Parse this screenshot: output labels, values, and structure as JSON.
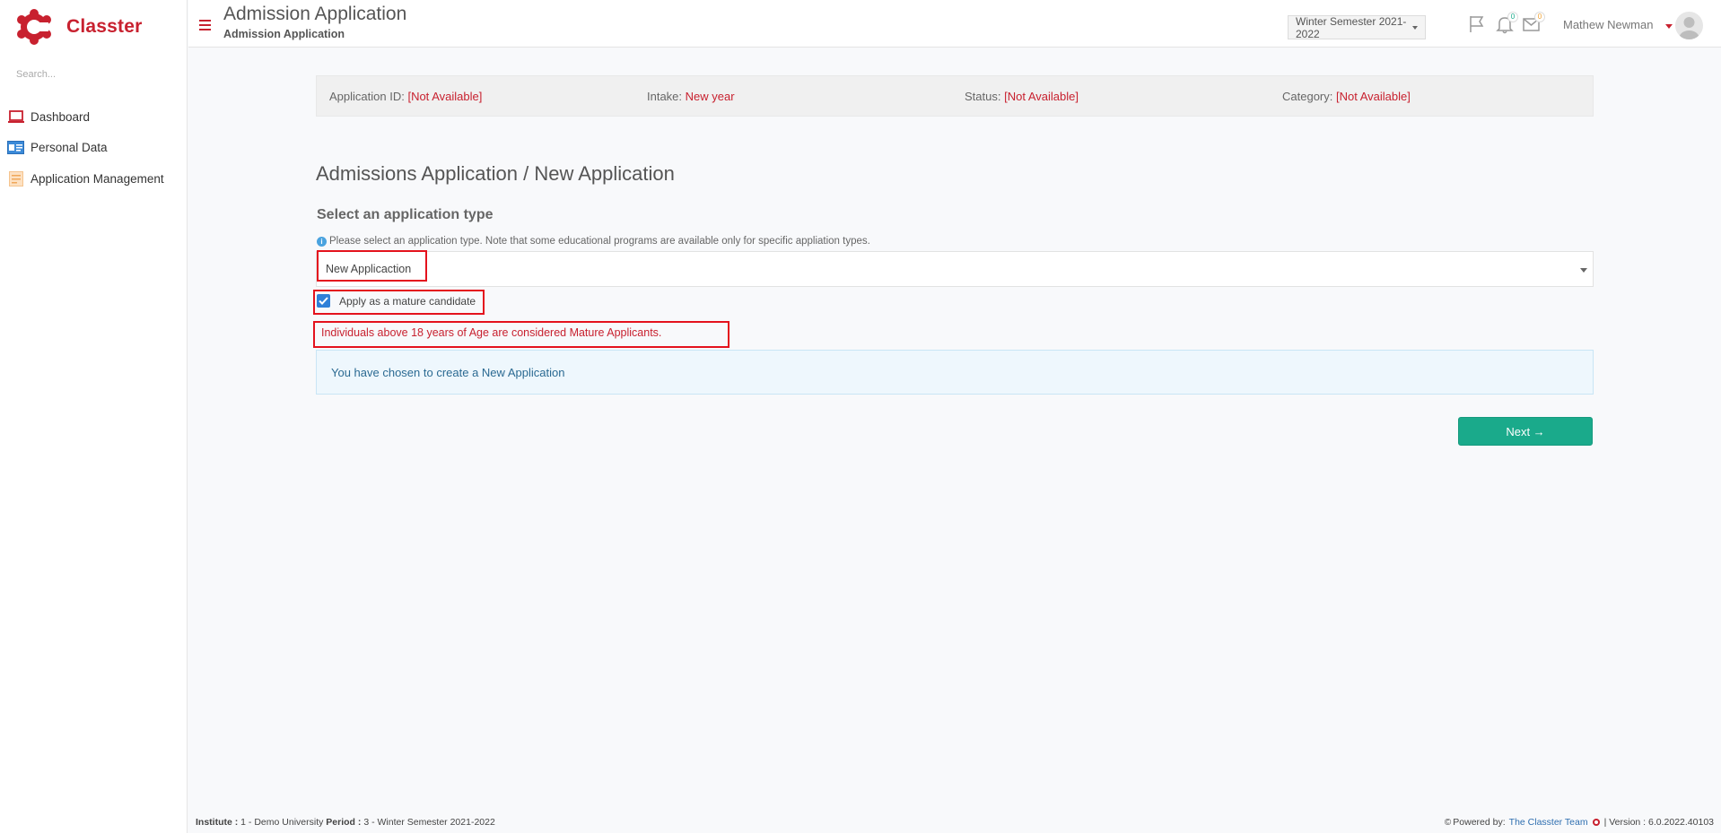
{
  "brand": {
    "name": "Classter",
    "accent": "#c8212f"
  },
  "sidebar": {
    "search_placeholder": "Search...",
    "items": [
      {
        "label": "Dashboard",
        "icon": "laptop-icon"
      },
      {
        "label": "Personal Data",
        "icon": "id-card-icon"
      },
      {
        "label": "Application Management",
        "icon": "document-icon"
      }
    ]
  },
  "header": {
    "title": "Admission Application",
    "subtitle": "Admission Application",
    "semester": "Winter Semester 2021-2022",
    "notifications_count": "0",
    "messages_count": "0",
    "user_name": "Mathew Newman"
  },
  "info": {
    "application_id_label": "Application ID:",
    "application_id_value": "[Not Available]",
    "intake_label": "Intake:",
    "intake_value": "New year",
    "status_label": "Status:",
    "status_value": "[Not Available]",
    "category_label": "Category:",
    "category_value": "[Not Available]"
  },
  "main": {
    "section_title": "Admissions Application / New Application",
    "subheading": "Select an application type",
    "help_text": "Please select an application type. Note that some educational programs are available only for specific appliation types.",
    "application_type_value": "New Applicaction",
    "mature_checkbox_label": "Apply as a mature candidate",
    "mature_checked": true,
    "mature_note": "Individuals above 18 years of Age are considered Mature Applicants.",
    "notice": "You have chosen to create a New Application",
    "next_label": "Next →"
  },
  "footer": {
    "institute_label": "Institute :",
    "institute_value": "1 - Demo University",
    "period_label": "Period :",
    "period_value": "3 - Winter Semester 2021-2022",
    "powered_by": "Powered by:",
    "team_link": "The Classter Team",
    "version": "| Version : 6.0.2022.40103"
  }
}
